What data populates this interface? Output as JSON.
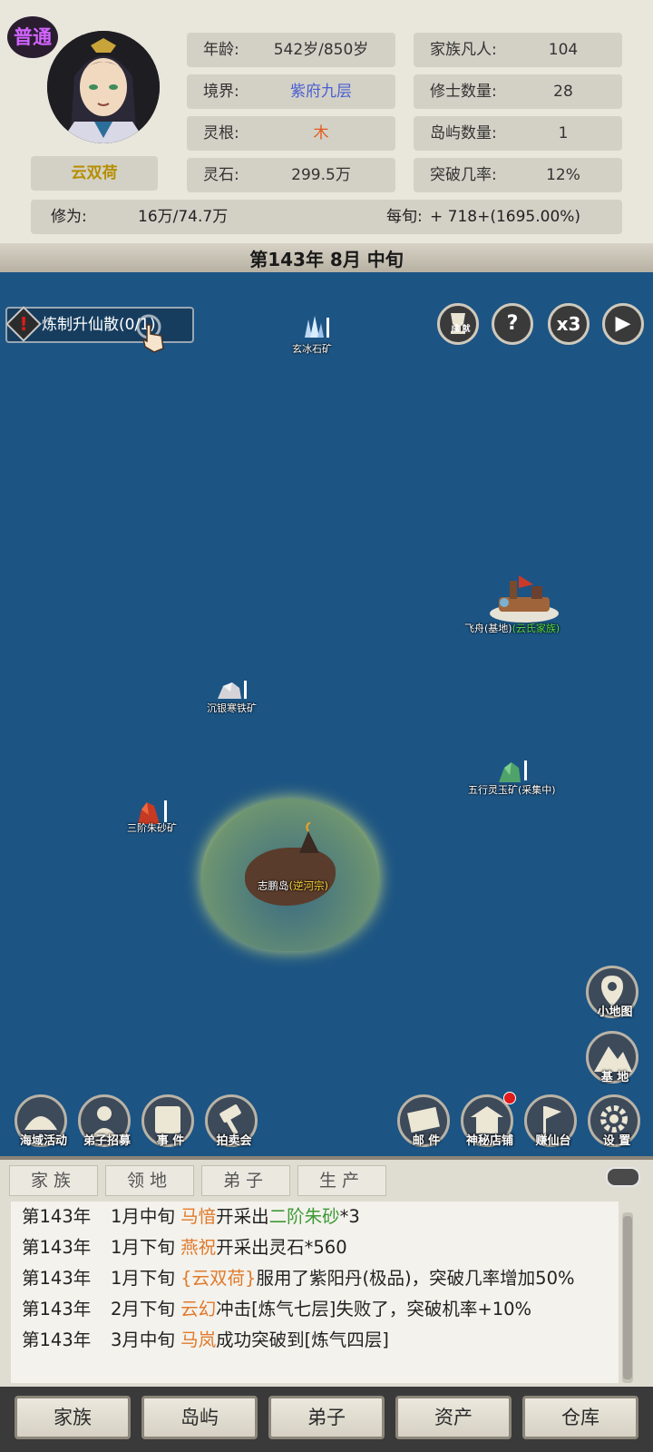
{
  "rank_badge": "普通",
  "character_name": "云双荷",
  "stats": {
    "age_label": "年龄:",
    "age_value": "542岁/850岁",
    "realm_label": "境界:",
    "realm_value": "紫府九层",
    "root_label": "灵根:",
    "root_value": "木",
    "stones_label": "灵石:",
    "stones_value": "299.5万",
    "mortals_label": "家族凡人:",
    "mortals_value": "104",
    "cultivators_label": "修士数量:",
    "cultivators_value": "28",
    "islands_label": "岛屿数量:",
    "islands_value": "1",
    "breakthrough_label": "突破几率:",
    "breakthrough_value": "12%",
    "cultivation_label": "修为:",
    "cultivation_value": "16万/74.7万",
    "per_period_label": "每旬:",
    "per_period_value": "+ 718+(1695.00%)"
  },
  "date": "第143年 8月 中旬",
  "quest": {
    "text": "炼制升仙散(0/1)"
  },
  "top_buttons": {
    "achievement_label": "成 就",
    "help": "?",
    "speed": "x3",
    "play": "▶"
  },
  "map_labels": {
    "ice_mine": "玄冰石矿",
    "airship_prefix": "飞舟(基地)",
    "airship_clan": "(云氏家族)",
    "silver_mine": "沉银寒铁矿",
    "jade_mine": "五行灵玉矿(采集中)",
    "cinnabar_mine": "三阶朱砂矿",
    "island_name": "志鹏岛",
    "island_sect": "(逆河宗)"
  },
  "side_buttons": {
    "minimap": "小地图",
    "base": "基 地"
  },
  "bottom_left_buttons": [
    "海域活动",
    "弟子招募",
    "事 件",
    "拍卖会"
  ],
  "bottom_right_buttons": [
    "邮 件",
    "神秘店铺",
    "赚仙台",
    "设 置"
  ],
  "log_tabs": [
    "家族",
    "领地",
    "弟子",
    "生产"
  ],
  "log": [
    {
      "year": "第143年",
      "period": "1月中旬",
      "who": "马愔",
      "text1": "开采出",
      "item": "二阶朱砂",
      "text2": "*3"
    },
    {
      "year": "第143年",
      "period": "1月下旬",
      "who": "燕祝",
      "text1": "开采出灵石*560"
    },
    {
      "year": "第143年",
      "period": "1月下旬",
      "who": "{云双荷}",
      "text1": "服用了紫阳丹(极品)，突破几率增加50%"
    },
    {
      "year": "第143年",
      "period": "2月下旬",
      "who": "云幻",
      "text1": "冲击[炼气七层]失败了，突破机率+10%"
    },
    {
      "year": "第143年",
      "period": "3月中旬",
      "who": "马岚",
      "text1": "成功突破到[炼气四层]"
    }
  ],
  "bottom_nav": [
    "家族",
    "岛屿",
    "弟子",
    "资产",
    "仓库"
  ],
  "colors": {
    "sea": "#1c5484",
    "parchment": "#e9e6dc",
    "realm_text": "#4a5fd1",
    "wood_root": "#e25a1c",
    "name_gold": "#b58f00"
  }
}
